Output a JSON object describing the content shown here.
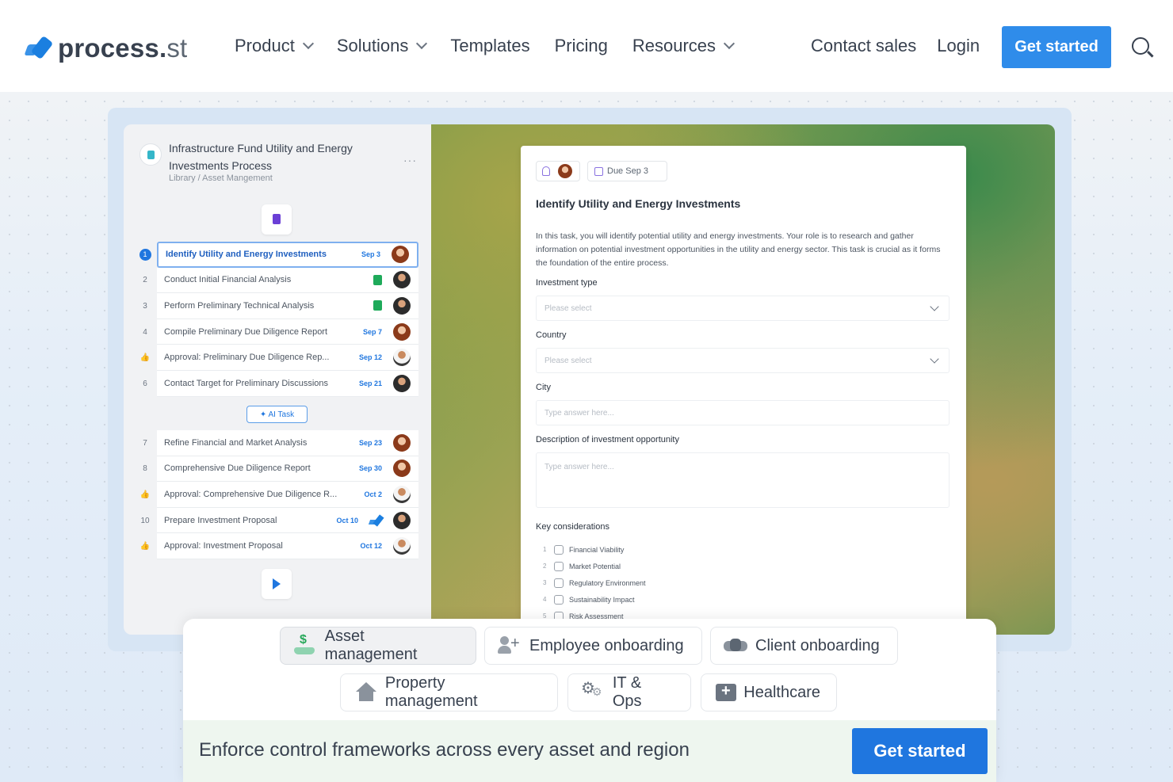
{
  "nav": {
    "logo_main": "process.",
    "logo_suffix": "st",
    "menu": [
      {
        "label": "Product",
        "dropdown": true
      },
      {
        "label": "Solutions",
        "dropdown": true
      },
      {
        "label": "Templates",
        "dropdown": false
      },
      {
        "label": "Pricing",
        "dropdown": false
      },
      {
        "label": "Resources",
        "dropdown": true
      }
    ],
    "contact_sales": "Contact sales",
    "login": "Login",
    "get_started": "Get started"
  },
  "process": {
    "title": "Infrastructure Fund Utility and Energy Investments Process",
    "breadcrumb": "Library / Asset Mangement",
    "more": "···",
    "ai_task": "✦ AI Task",
    "tasks_top": [
      {
        "num": "1",
        "label": "Identify Utility and Energy Investments",
        "due": "Sep 3",
        "avatar": "a",
        "selected": true
      },
      {
        "num": "2",
        "label": "Conduct Initial Financial Analysis",
        "due": "",
        "avatar": "b",
        "sheet": true
      },
      {
        "num": "3",
        "label": "Perform Preliminary Technical Analysis",
        "due": "",
        "avatar": "b",
        "sheet": true
      },
      {
        "num": "4",
        "label": "Compile Preliminary Due Diligence Report",
        "due": "Sep 7",
        "avatar": "a"
      },
      {
        "num": "👍",
        "label": "Approval: Preliminary Due Diligence Rep...",
        "due": "Sep 12",
        "avatar": "c"
      },
      {
        "num": "6",
        "label": "Contact Target for Preliminary Discussions",
        "due": "Sep 21",
        "avatar": "b"
      }
    ],
    "tasks_bottom": [
      {
        "num": "7",
        "label": "Refine Financial and Market Analysis",
        "due": "Sep 23",
        "avatar": "a"
      },
      {
        "num": "8",
        "label": "Comprehensive Due Diligence Report",
        "due": "Sep 30",
        "avatar": "a"
      },
      {
        "num": "👍",
        "label": "Approval: Comprehensive Due Diligence R...",
        "due": "Oct 2",
        "avatar": "c"
      },
      {
        "num": "10",
        "label": "Prepare Investment Proposal",
        "due": "Oct 10",
        "avatar": "b",
        "logo": true
      },
      {
        "num": "👍",
        "label": "Approval: Investment Proposal",
        "due": "Oct 12",
        "avatar": "c"
      }
    ]
  },
  "task_card": {
    "due": "Due Sep 3",
    "title": "Identify Utility and Energy Investments",
    "description": "In this task, you will identify potential utility and energy investments. Your role is to research and gather information on potential investment opportunities in the utility and energy sector. This task is crucial as it forms the foundation of the entire process.",
    "investment_type_label": "Investment type",
    "investment_type_placeholder": "Please select",
    "country_label": "Country",
    "country_placeholder": "Please select",
    "city_label": "City",
    "city_placeholder": "Type answer here...",
    "desc_label": "Description of investment opportunity",
    "desc_placeholder": "Type answer here...",
    "key_label": "Key considerations",
    "checklist": [
      {
        "n": "1",
        "label": "Financial Viability"
      },
      {
        "n": "2",
        "label": "Market Potential"
      },
      {
        "n": "3",
        "label": "Regulatory Environment"
      },
      {
        "n": "4",
        "label": "Sustainability Impact"
      },
      {
        "n": "5",
        "label": "Risk Assessment"
      }
    ]
  },
  "categories": {
    "asset": "Asset management",
    "employee": "Employee onboarding",
    "client": "Client onboarding",
    "property": "Property management",
    "itops": "IT & Ops",
    "healthcare": "Healthcare"
  },
  "cta": {
    "text": "Enforce control frameworks across every asset and region",
    "button": "Get started"
  },
  "colors": {
    "primary": "#1f76df",
    "nav_button": "#2f8cea",
    "cta_bar": "#eef6ef"
  }
}
